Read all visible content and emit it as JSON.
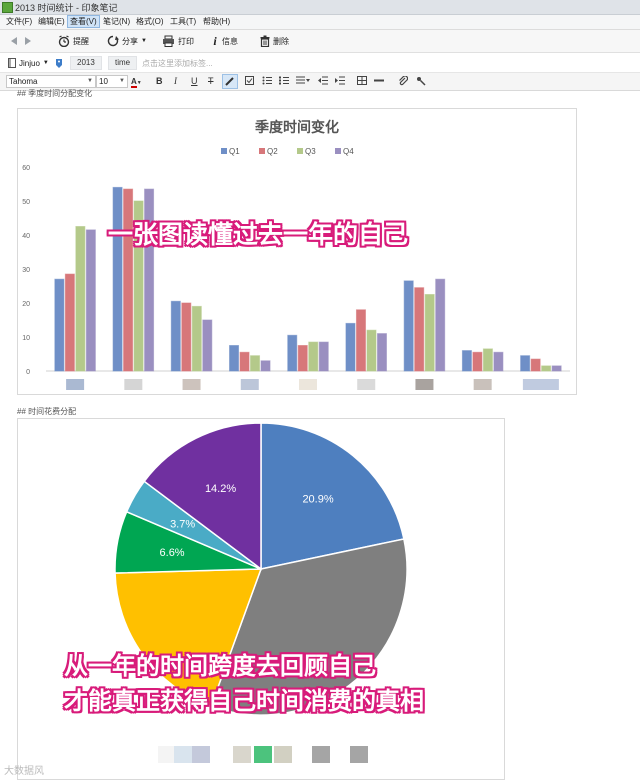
{
  "window": {
    "title": "2013 时间统计 - 印象笔记"
  },
  "menu": [
    {
      "label": "文件(F)"
    },
    {
      "label": "编辑(E)"
    },
    {
      "label": "查看(V)",
      "active": true
    },
    {
      "label": "笔记(N)"
    },
    {
      "label": "格式(O)"
    },
    {
      "label": "工具(T)"
    },
    {
      "label": "帮助(H)"
    }
  ],
  "toolbar": {
    "remind": "提醒",
    "share": "分享",
    "print": "打印",
    "info": "信息",
    "delete": "删除"
  },
  "note": {
    "notebook": "Jinjuo",
    "tags": [
      "2013",
      "time"
    ],
    "tag_hint": "点击这里添加标签..."
  },
  "format": {
    "font": "Tahoma",
    "size": "10",
    "bold": "B",
    "italic": "I",
    "underline": "U",
    "strike": "T"
  },
  "headings": {
    "bar": "## 季度时间分配变化",
    "pie": "## 时间花费分配"
  },
  "overlays": {
    "top": "一张图读懂过去一年的自己",
    "bottom1": "从一年的时间跨度去回顾自己",
    "bottom2": "才能真正获得自己时间消费的真相"
  },
  "watermark": "大数据风",
  "chart_data": [
    {
      "type": "bar",
      "title": "季度时间变化",
      "legend_position": "top",
      "ylim": [
        0,
        60
      ],
      "yticks": [
        0,
        10,
        20,
        30,
        40,
        50,
        60
      ],
      "grid": false,
      "series": [
        {
          "name": "Q1",
          "color": "#6f8fc7",
          "values": [
            27,
            54,
            20.5,
            7.5,
            10.5,
            14,
            26.5,
            6,
            4.5
          ]
        },
        {
          "name": "Q2",
          "color": "#d7777a",
          "values": [
            28.5,
            53.5,
            20,
            5.5,
            7.5,
            18,
            24.5,
            5.5,
            3.5
          ]
        },
        {
          "name": "Q3",
          "color": "#b4c98a",
          "values": [
            42.5,
            50,
            19,
            4.5,
            8.5,
            12,
            22.5,
            6.5,
            1.5
          ]
        },
        {
          "name": "Q4",
          "color": "#9a8fc0",
          "values": [
            41.5,
            53.5,
            15,
            3,
            8.5,
            11,
            27,
            5.5,
            1.5
          ]
        }
      ],
      "category_swatches": [
        "#aab9d2",
        "#d5d5d5",
        "#cdc3bd",
        "#bcc6d9",
        "#ece6dc",
        "#dadada",
        "#a9a39f",
        "#c9c1bb",
        "#c0cbe0"
      ]
    },
    {
      "type": "pie",
      "slices": [
        {
          "value": 20.9,
          "label": "20.9%",
          "color": "#4e7fbf",
          "show_label": true
        },
        {
          "value": 32.6,
          "label": "",
          "color": "#7f7f7f",
          "show_label": false
        },
        {
          "value": 18.3,
          "label": "",
          "color": "#ffc000",
          "show_label": false
        },
        {
          "value": 6.6,
          "label": "6.6%",
          "color": "#00a652",
          "show_label": true
        },
        {
          "value": 3.7,
          "label": "3.7%",
          "color": "#4aabc6",
          "show_label": true
        },
        {
          "value": 14.2,
          "label": "14.2%",
          "color": "#7030a0",
          "show_label": true
        }
      ],
      "legend_swatches": [
        "#f4f4f4",
        "#d9e4ee",
        "#c4c9db",
        "#d9d6cc",
        "#4cc37d",
        "#d2d0c2",
        "#a5a5a5",
        "#a5a5a5"
      ]
    }
  ]
}
